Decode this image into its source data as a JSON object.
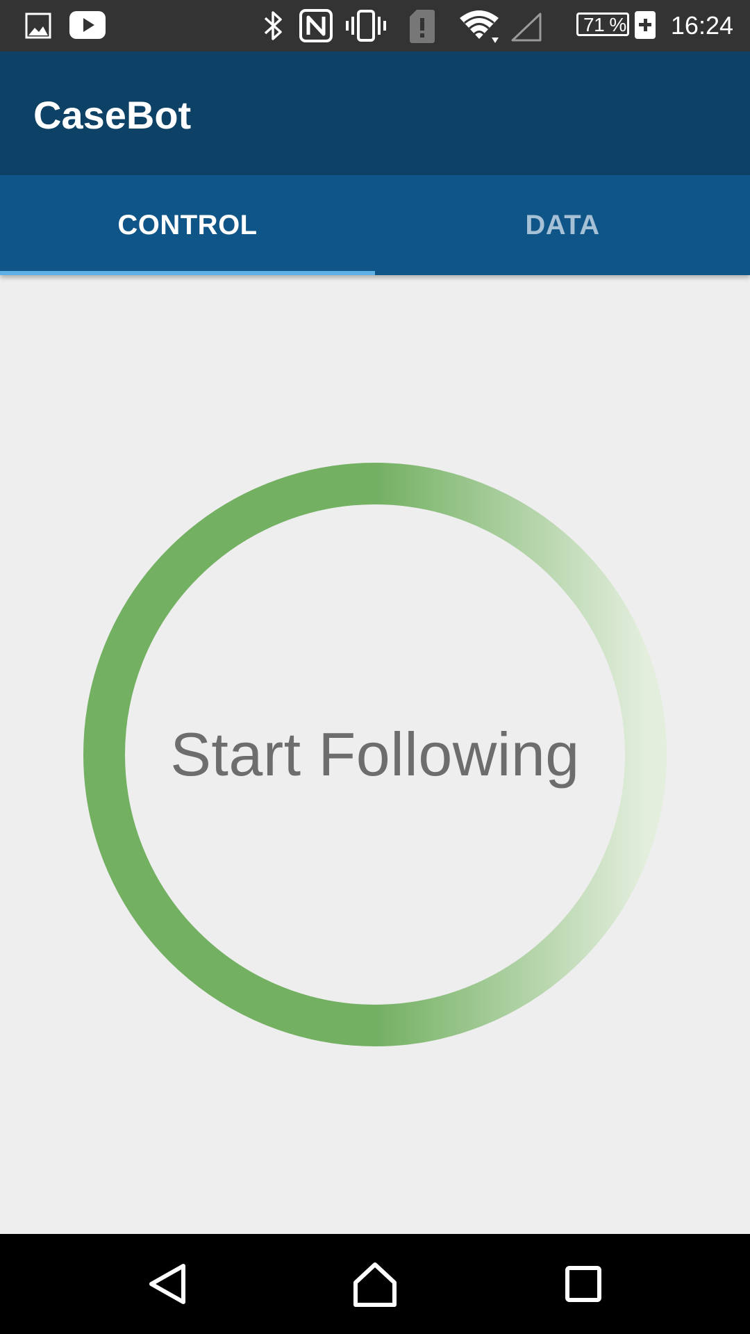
{
  "status_bar": {
    "battery_percent": "71 %",
    "time": "16:24",
    "icons": [
      "gallery-icon",
      "youtube-icon",
      "bluetooth-icon",
      "nfc-icon",
      "vibrate-icon",
      "sim-alert-icon",
      "wifi-icon",
      "signal-icon",
      "battery-charging-icon"
    ]
  },
  "app_bar": {
    "title": "CaseBot"
  },
  "tabs": [
    {
      "label": "CONTROL",
      "selected": true
    },
    {
      "label": "DATA",
      "selected": false
    }
  ],
  "main": {
    "button_label": "Start Following",
    "ring_colors": {
      "solid": "#73b062",
      "fade": "#e3eedd"
    }
  },
  "nav_bar": {
    "icons": [
      "back-icon",
      "home-icon",
      "recents-icon"
    ]
  },
  "colors": {
    "status_bar": "#333333",
    "app_bar": "#0d4266",
    "tab_bar": "#105587",
    "tab_indicator": "#5fb0e4",
    "background": "#eeeeee"
  }
}
